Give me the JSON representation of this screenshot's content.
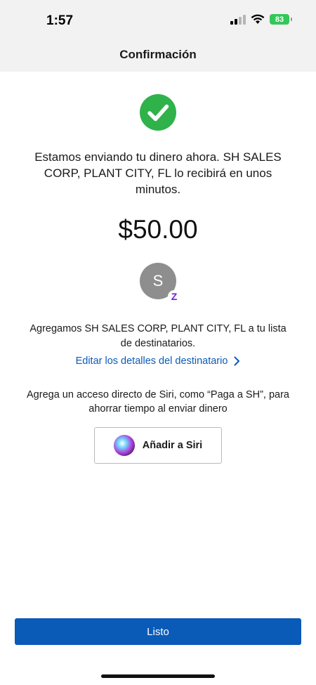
{
  "status_bar": {
    "time": "1:57",
    "battery": "83",
    "icons": [
      "cellular-signal-icon",
      "wifi-icon",
      "battery-charging-icon"
    ]
  },
  "header": {
    "title": "Confirmación"
  },
  "confirmation": {
    "status_icon": "checkmark-circle-icon",
    "message": "Estamos enviando tu dinero ahora. SH SALES CORP, PLANT CITY, FL lo recibirá en unos minutos.",
    "amount": "$50.00"
  },
  "recipient": {
    "avatar_initial": "S",
    "badge_icon": "zelle-icon",
    "badge_glyph": "Z",
    "added_message": "Agregamos SH SALES CORP, PLANT CITY, FL a tu lista de destinatarios.",
    "edit_link_label": "Editar los detalles del destinatario"
  },
  "siri": {
    "prompt": "Agrega un acceso directo de Siri, como “Paga a SH”, para ahorrar tiempo al enviar dinero",
    "button_label": "Añadir a Siri",
    "icon": "siri-icon"
  },
  "footer": {
    "done_label": "Listo"
  },
  "colors": {
    "accent": "#0a5bb8",
    "success": "#2fb24a",
    "zelle": "#6d1ed4",
    "header_bg": "#f2f2f2",
    "battery": "#34c759"
  }
}
